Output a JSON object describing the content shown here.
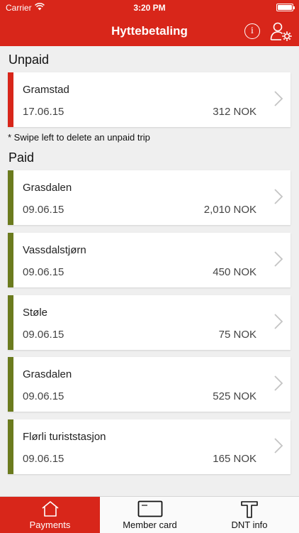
{
  "status_bar": {
    "carrier": "Carrier",
    "time": "3:20 PM"
  },
  "header": {
    "title": "Hyttebetaling",
    "info_icon": "i"
  },
  "colors": {
    "brand": "#d8261a",
    "unpaid_stripe": "#d8261a",
    "paid_stripe": "#6b7b1e"
  },
  "unpaid": {
    "title": "Unpaid",
    "items": [
      {
        "name": "Gramstad",
        "date": "17.06.15",
        "amount": "312 NOK"
      }
    ],
    "note": "* Swipe left to delete an unpaid trip"
  },
  "paid": {
    "title": "Paid",
    "items": [
      {
        "name": "Grasdalen",
        "date": "09.06.15",
        "amount": "2,010 NOK"
      },
      {
        "name": "Vassdalstjørn",
        "date": "09.06.15",
        "amount": "450 NOK"
      },
      {
        "name": "Støle",
        "date": "09.06.15",
        "amount": "75 NOK"
      },
      {
        "name": "Grasdalen",
        "date": "09.06.15",
        "amount": "525 NOK"
      },
      {
        "name": "Flørli turiststasjon",
        "date": "09.06.15",
        "amount": "165 NOK"
      }
    ]
  },
  "tabs": [
    {
      "label": "Payments",
      "icon": "house-icon",
      "active": true
    },
    {
      "label": "Member card",
      "icon": "card-icon",
      "active": false
    },
    {
      "label": "DNT info",
      "icon": "dnt-logo-icon",
      "active": false
    }
  ]
}
